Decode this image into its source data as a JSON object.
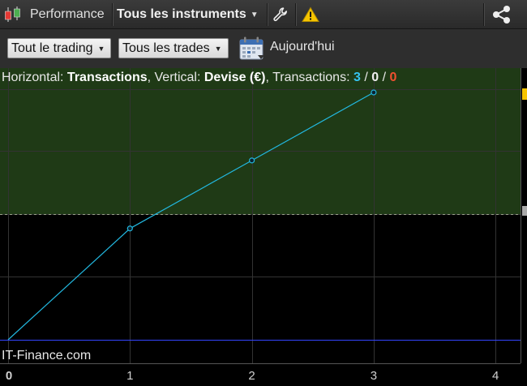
{
  "toolbar": {
    "performance_label": "Performance",
    "instruments_label": "Tous les instruments"
  },
  "filters": {
    "trading_selected": "Tout le trading",
    "trades_selected": "Tous les trades",
    "date_label": "Aujourd'hui"
  },
  "chart_info": {
    "horizontal_prefix": "Horizontal: ",
    "horizontal_value": "Transactions",
    "vertical_prefix": ", Vertical: ",
    "vertical_value": "Devise (€)",
    "transactions_prefix": ", Transactions: ",
    "winning": "3",
    "sep1": " / ",
    "neutral": "0",
    "sep2": " / ",
    "losing": "0"
  },
  "watermark": "IT-Finance.com",
  "colors": {
    "profit_zone": "#1f3a16",
    "line": "#22b8e0",
    "baseline": "#3344ff",
    "win": "#35c3f0",
    "loss": "#f05030"
  },
  "chart_data": {
    "type": "line",
    "x": [
      0,
      1,
      2,
      3
    ],
    "y": [
      0,
      0.9,
      1.45,
      2.0
    ],
    "x_ticks": [
      "0",
      "1",
      "2",
      "3",
      "4"
    ],
    "xlim": [
      0,
      4.2
    ],
    "ylim": [
      -0.15,
      2.2
    ],
    "xlabel": "Transactions",
    "ylabel": "Devise (€)",
    "grid": true
  }
}
